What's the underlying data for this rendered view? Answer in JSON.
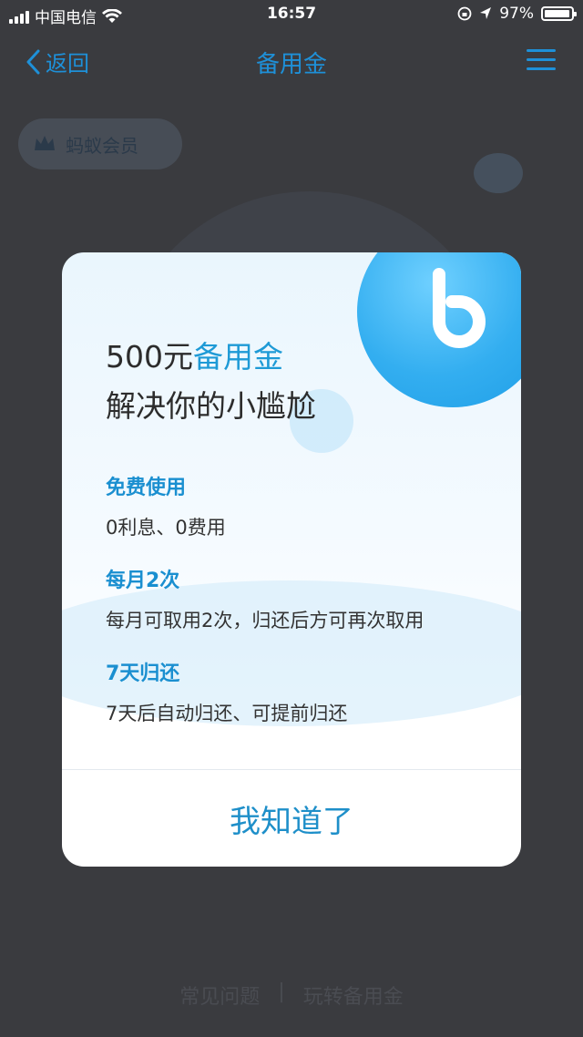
{
  "status_bar": {
    "carrier": "中国电信",
    "time": "16:57",
    "battery": "97%"
  },
  "nav": {
    "back_label": "返回",
    "title": "备用金"
  },
  "background": {
    "member_badge": "蚂蚁会员",
    "links": [
      "常见问题",
      "玩转备用金"
    ]
  },
  "modal": {
    "headline_amount": "500元",
    "headline_product": "备用金",
    "headline_line2": "解决你的小尴尬",
    "features": [
      {
        "title": "免费使用",
        "desc": "0利息、0费用"
      },
      {
        "title": "每月2次",
        "desc": "每月可取用2次，归还后方可再次取用"
      },
      {
        "title": "7天归还",
        "desc": "7天后自动归还、可提前归还"
      }
    ],
    "confirm_label": "我知道了"
  },
  "colors": {
    "accent": "#1e9ad6",
    "nav_blue": "#1e90d8"
  }
}
